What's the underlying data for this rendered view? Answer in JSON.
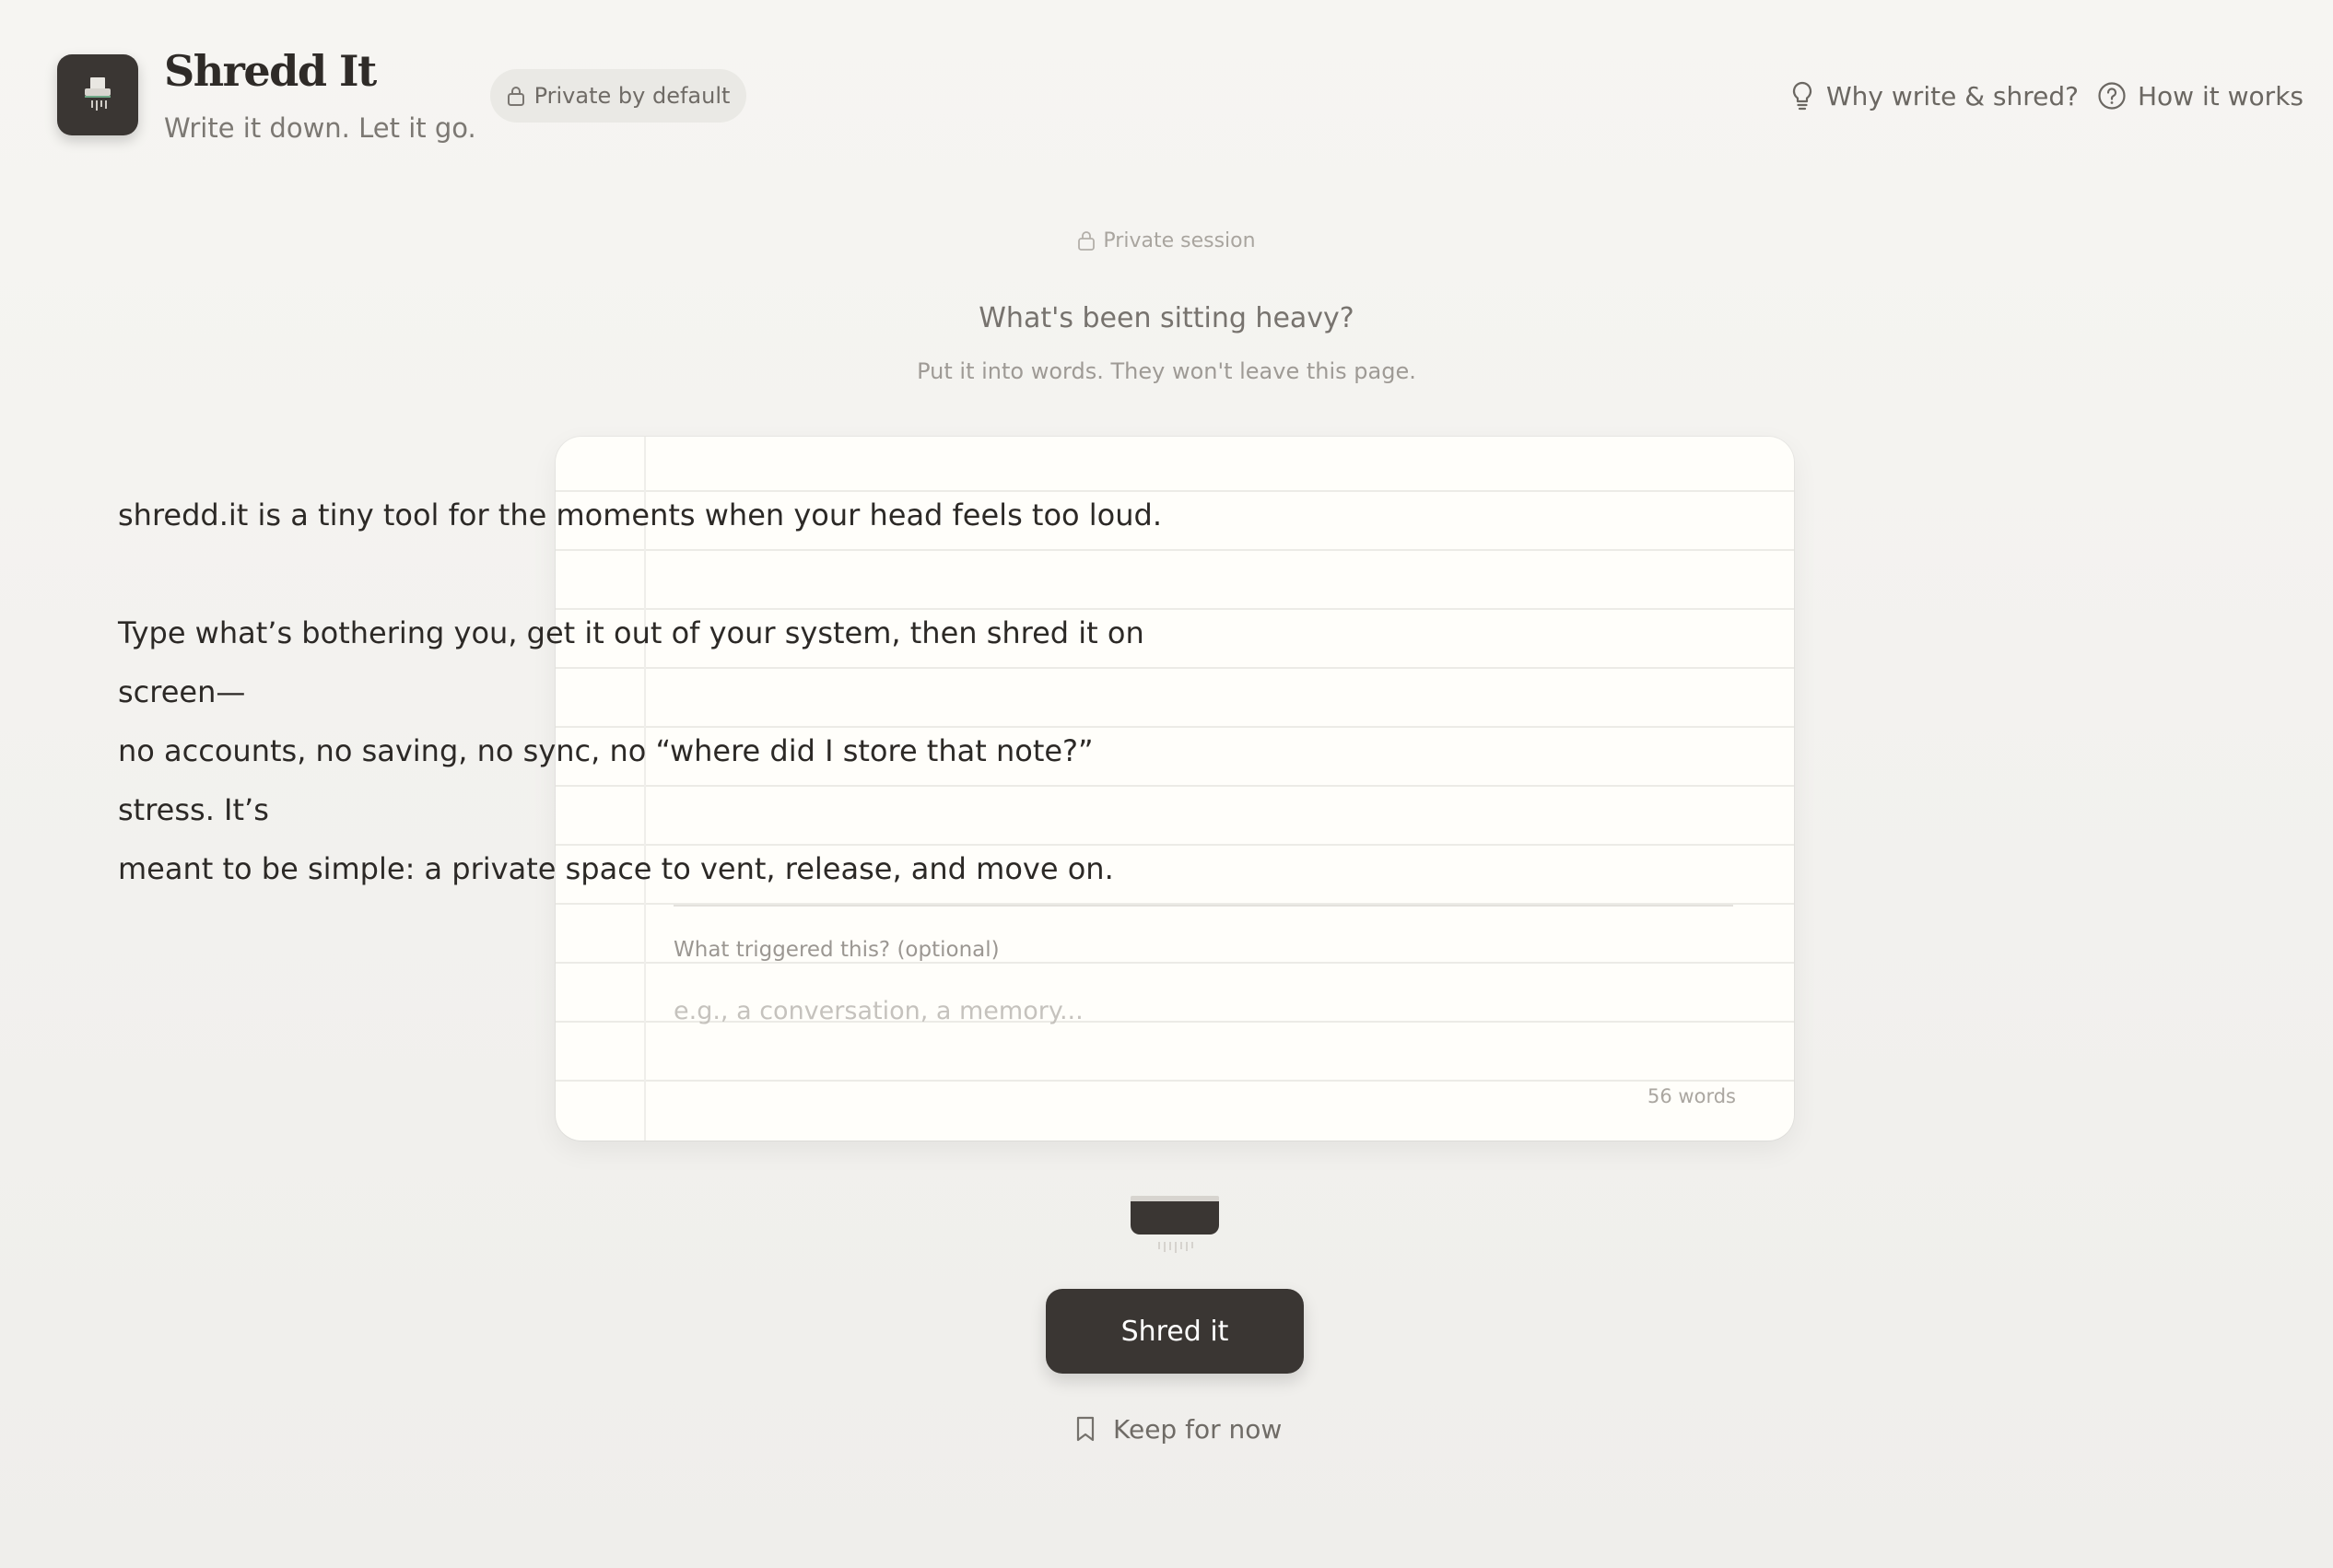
{
  "header": {
    "brand_title": "Shredd It",
    "tagline": "Write it down. Let it go.",
    "privacy_badge": "Private by default",
    "nav": {
      "why_label": "Why write & shred?",
      "how_label": "How it works"
    }
  },
  "session": {
    "label": "Private session",
    "prompt_title": "What's been sitting heavy?",
    "prompt_subtitle": "Put it into words. They won't leave this page."
  },
  "editor": {
    "paragraphs": [
      "shredd.it is a tiny tool for the moments when your head feels too loud.",
      "Type what’s bothering you, get it out of your system, then shred it on screen—\nno accounts, no saving, no sync, no “where did I store that note?” stress. It’s\nmeant to be simple: a private space to vent, release, and move on."
    ],
    "trigger_label": "What triggered this? (optional)",
    "trigger_placeholder": "e.g., a conversation, a memory...",
    "trigger_value": "",
    "word_count": "56 words"
  },
  "actions": {
    "shred_label": "Shred it",
    "keep_label": "Keep for now"
  },
  "icons": {
    "logo": "paper-shredder-icon",
    "badge": "lock-icon",
    "why": "lightbulb-icon",
    "how": "help-circle-icon",
    "session": "lock-icon",
    "keep": "bookmark-icon"
  },
  "colors": {
    "background": "#f4f3f0",
    "paper": "#fffefa",
    "primary_button": "#3a3633",
    "text_primary": "#2c2926",
    "text_muted": "#77736e"
  }
}
